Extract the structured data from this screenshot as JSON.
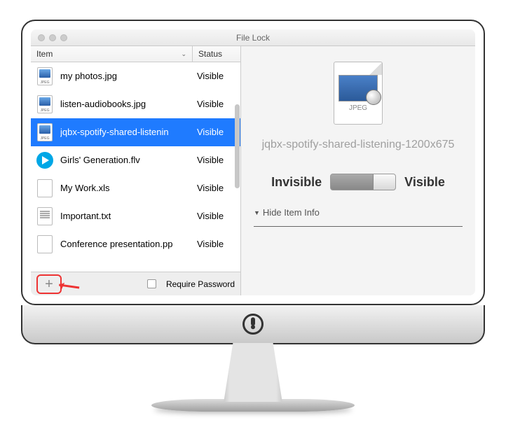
{
  "window": {
    "title": "File Lock",
    "columns": {
      "item": "Item",
      "status": "Status"
    },
    "require_password": "Require Password",
    "files": [
      {
        "name": "my photos.jpg",
        "status": "Visible",
        "icon": "jpeg",
        "selected": false
      },
      {
        "name": "listen-audiobooks.jpg",
        "status": "Visible",
        "icon": "jpeg",
        "selected": false
      },
      {
        "name": "jqbx-spotify-shared-listenin",
        "status": "Visible",
        "icon": "jpeg",
        "selected": true
      },
      {
        "name": "Girls' Generation.flv",
        "status": "Visible",
        "icon": "flv",
        "selected": false
      },
      {
        "name": "My Work.xls",
        "status": "Visible",
        "icon": "generic",
        "selected": false
      },
      {
        "name": "Important.txt",
        "status": "Visible",
        "icon": "txt",
        "selected": false
      },
      {
        "name": "Conference presentation.pp",
        "status": "Visible",
        "icon": "generic",
        "selected": false
      }
    ]
  },
  "detail": {
    "icon_label": "JPEG",
    "filename": "jqbx-spotify-shared-listening-1200x675",
    "invisible_label": "Invisible",
    "visible_label": "Visible",
    "toggle_state": "visible",
    "hide_info_label": "Hide Item Info"
  }
}
